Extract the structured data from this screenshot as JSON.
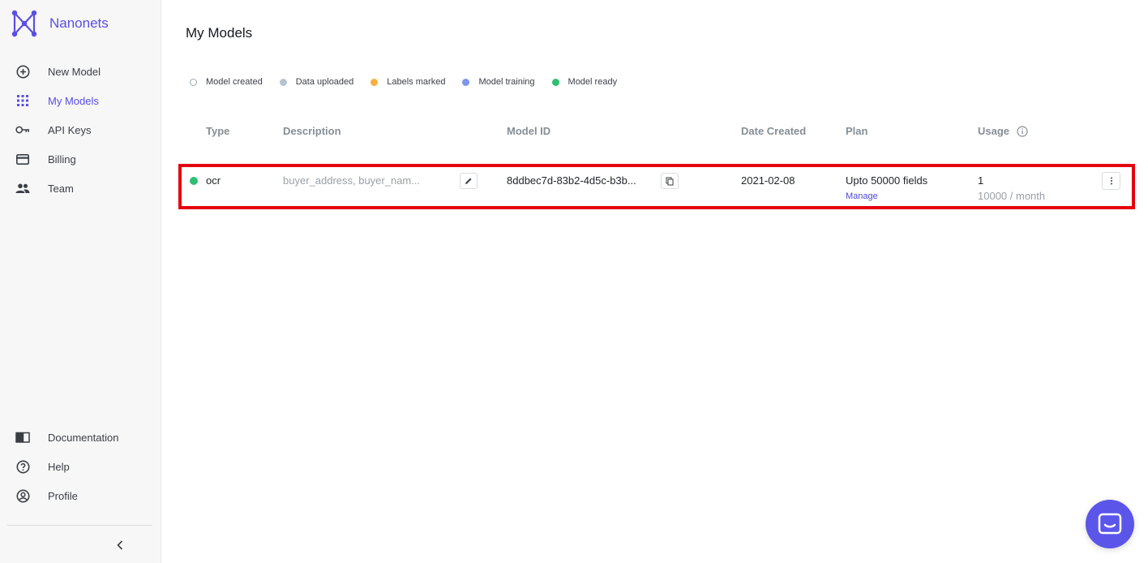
{
  "brand": {
    "name": "Nanonets",
    "color": "#5a4ee3"
  },
  "sidebar": {
    "items": [
      {
        "label": "New Model",
        "icon": "plus-circle-icon",
        "active": false
      },
      {
        "label": "My Models",
        "icon": "grid-icon",
        "active": true
      },
      {
        "label": "API Keys",
        "icon": "key-icon",
        "active": false
      },
      {
        "label": "Billing",
        "icon": "credit-card-icon",
        "active": false
      },
      {
        "label": "Team",
        "icon": "people-icon",
        "active": false
      }
    ],
    "bottom_items": [
      {
        "label": "Documentation",
        "icon": "book-icon"
      },
      {
        "label": "Help",
        "icon": "help-circle-icon"
      },
      {
        "label": "Profile",
        "icon": "user-circle-icon"
      }
    ],
    "collapse_icon": "chevron-left-icon"
  },
  "main": {
    "title": "My Models",
    "legend": [
      {
        "label": "Model created",
        "color": "#9aa7b3",
        "hollow": true
      },
      {
        "label": "Data uploaded",
        "color": "#b7c3d0",
        "hollow": false
      },
      {
        "label": "Labels marked",
        "color": "#f5b041",
        "hollow": false
      },
      {
        "label": "Model training",
        "color": "#7b96ec",
        "hollow": false
      },
      {
        "label": "Model ready",
        "color": "#2fbf71",
        "hollow": false
      }
    ],
    "table": {
      "columns": [
        "Type",
        "Description",
        "Model ID",
        "Date Created",
        "Plan",
        "Usage"
      ],
      "rows": [
        {
          "status_color": "#2fbf71",
          "type": "ocr",
          "description": "buyer_address, buyer_nam...",
          "model_id": "8ddbec7d-83b2-4d5c-b3b...",
          "date_created": "2021-02-08",
          "plan": "Upto 50000 fields",
          "plan_action": "Manage",
          "usage": "1",
          "usage_limit": "10000 / month"
        }
      ]
    }
  },
  "highlight_color": "#e5000e",
  "chat": {
    "icon": "chat-icon",
    "color": "#5b55ea"
  }
}
